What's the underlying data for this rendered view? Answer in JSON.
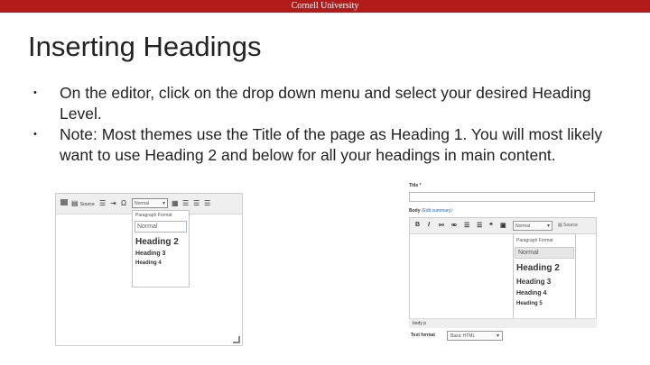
{
  "header": {
    "org": "Cornell University"
  },
  "slide": {
    "title": "Inserting Headings",
    "bullets": [
      "On the editor, click on the drop down menu and select your desired Heading Level.",
      "Note: Most themes use the Title of the page as Heading 1.  You will most likely want to use Heading 2 and below for all your headings in main content."
    ]
  },
  "shot1": {
    "toolbar_source": "Source",
    "select_value": "Normal",
    "dropdown": {
      "header": "Paragraph Format",
      "items": [
        "Normal",
        "Heading 2",
        "Heading 3",
        "Heading 4"
      ]
    }
  },
  "shot2": {
    "title_label": "Title",
    "body_label": "Body",
    "edit_summary": "(Edit summary)",
    "select_value": "Normal",
    "source_label": "Source",
    "dropdown": {
      "header": "Paragraph Format",
      "items": [
        "Normal",
        "Heading 2",
        "Heading 3",
        "Heading 4",
        "Heading 5"
      ]
    },
    "status_path": "body  p",
    "text_format_label": "Text format",
    "text_format_value": "Basic HTML"
  }
}
